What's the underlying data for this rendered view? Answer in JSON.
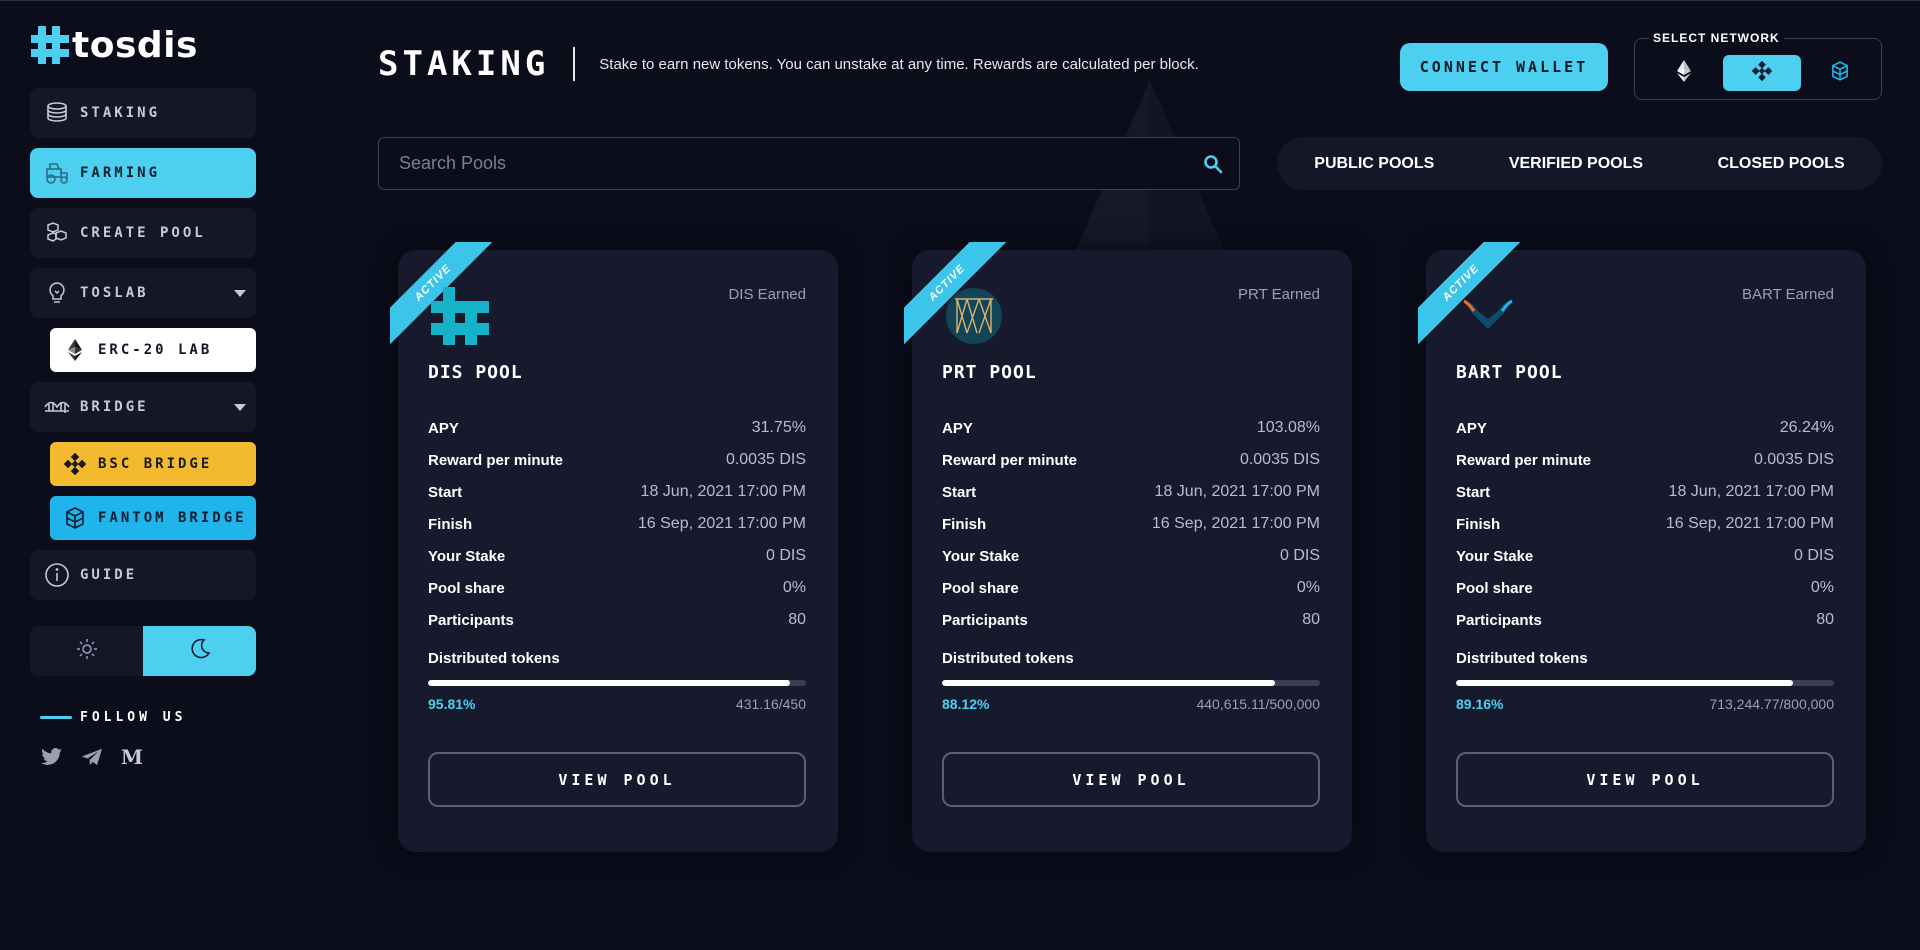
{
  "app": {
    "logo_text": "tosdis"
  },
  "sidebar": {
    "items": [
      {
        "label": "STAKING",
        "icon": "coins-stack-icon",
        "active": false
      },
      {
        "label": "FARMING",
        "icon": "tractor-icon",
        "active": true
      },
      {
        "label": "CREATE POOL",
        "icon": "cubes-icon",
        "active": false
      },
      {
        "label": "TOSLAB",
        "icon": "lightbulb-icon",
        "active": false,
        "expanded": true
      },
      {
        "label": "BRIDGE",
        "icon": "bridge-icon",
        "active": false,
        "expanded": true
      },
      {
        "label": "GUIDE",
        "icon": "info-icon",
        "active": false
      }
    ],
    "toslab_sub": {
      "label": "ERC-20 LAB",
      "icon": "ethereum-icon"
    },
    "bridge_sub": [
      {
        "label": "BSC BRIDGE",
        "icon": "binance-icon",
        "color": "#f3ba2f"
      },
      {
        "label": "FANTOM BRIDGE",
        "icon": "fantom-icon",
        "color": "#1fb5ea"
      }
    ],
    "theme": {
      "light_icon": "sun-icon",
      "dark_icon": "moon-icon",
      "selected": "dark"
    },
    "follow_label": "FOLLOW US",
    "socials": [
      "twitter-icon",
      "telegram-icon",
      "medium-icon"
    ],
    "medium_glyph": "M"
  },
  "header": {
    "title": "STAKING",
    "description": "Stake to earn new tokens. You can unstake at any time. Rewards are calculated per block.",
    "connect_wallet": "CONNECT WALLET",
    "network_label": "SELECT NETWORK",
    "networks": [
      "ethereum-icon",
      "binance-icon",
      "fantom-icon"
    ],
    "selected_network": "binance"
  },
  "search": {
    "placeholder": "Search Pools",
    "value": ""
  },
  "filters": [
    "PUBLIC POOLS",
    "VERIFIED POOLS",
    "CLOSED POOLS"
  ],
  "labels": {
    "apy": "APY",
    "reward": "Reward per minute",
    "start": "Start",
    "finish": "Finish",
    "stake": "Your Stake",
    "share": "Pool share",
    "participants": "Participants",
    "distributed": "Distributed tokens",
    "view_pool": "VIEW POOL",
    "ribbon": "ACTIVE"
  },
  "pools": [
    {
      "name": "DIS POOL",
      "earned": "DIS Earned",
      "logo": "tosdis-logo-icon",
      "apy": "31.75%",
      "reward": "0.0035 DIS",
      "start": "18 Jun, 2021 17:00 PM",
      "finish": "16 Sep, 2021 17:00 PM",
      "stake": "0 DIS",
      "share": "0%",
      "participants": "80",
      "percent": "95.81%",
      "progress": 0.9581,
      "distributed": "431.16/450"
    },
    {
      "name": "PRT POOL",
      "earned": "PRT Earned",
      "logo": "portion-logo-icon",
      "apy": "103.08%",
      "reward": "0.0035 DIS",
      "start": "18 Jun, 2021 17:00 PM",
      "finish": "16 Sep, 2021 17:00 PM",
      "stake": "0 DIS",
      "share": "0%",
      "participants": "80",
      "percent": "88.12%",
      "progress": 0.8812,
      "distributed": "440,615.11/500,000"
    },
    {
      "name": "BART POOL",
      "earned": "BART Earned",
      "logo": "bart-logo-icon",
      "apy": "26.24%",
      "reward": "0.0035 DIS",
      "start": "18 Jun, 2021 17:00 PM",
      "finish": "16 Sep, 2021 17:00 PM",
      "stake": "0 DIS",
      "share": "0%",
      "participants": "80",
      "percent": "89.16%",
      "progress": 0.8916,
      "distributed": "713,244.77/800,000"
    }
  ],
  "colors": {
    "accent": "#4dd0ef",
    "background": "#0b0d1b",
    "card": "#171a2c",
    "bsc": "#f3ba2f",
    "fantom": "#1fb5ea"
  }
}
